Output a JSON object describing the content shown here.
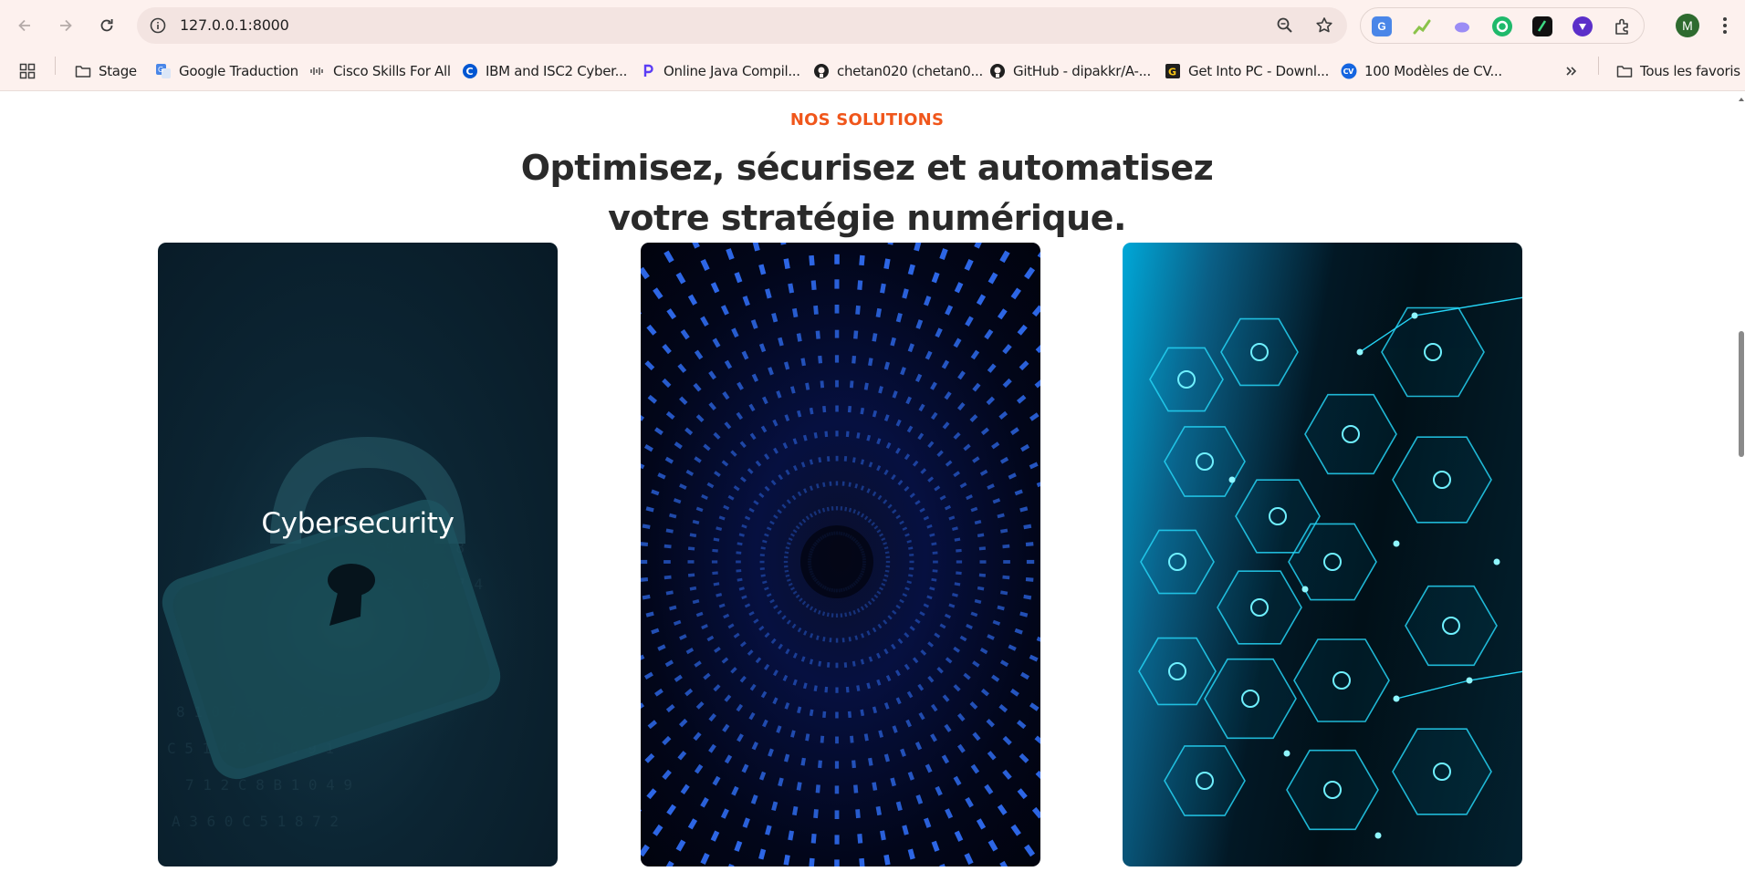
{
  "browser": {
    "url": "127.0.0.1:8000",
    "profile_initial": "M",
    "bookmarks": [
      {
        "label": "Stage",
        "icon": "folder-icon"
      },
      {
        "label": "Google Traduction",
        "icon": "google-translate-icon"
      },
      {
        "label": "Cisco Skills For All",
        "icon": "cisco-icon"
      },
      {
        "label": "IBM and ISC2 Cyber...",
        "icon": "coursera-icon"
      },
      {
        "label": "Online Java Compil...",
        "icon": "programiz-icon"
      },
      {
        "label": "chetan020 (chetan0...",
        "icon": "github-icon"
      },
      {
        "label": "GitHub - dipakkr/A-...",
        "icon": "github-icon"
      },
      {
        "label": "Get Into PC - Downl...",
        "icon": "getintopc-icon"
      },
      {
        "label": "100 Modèles de CV...",
        "icon": "cv-icon"
      }
    ],
    "all_bookmarks_label": "Tous les favoris",
    "colors": {
      "chrome_bg": "#fdf1ee",
      "omnibox_bg": "#f3e4e1",
      "avatar": "#2e6b2f"
    }
  },
  "section": {
    "eyebrow": "NOS SOLUTIONS",
    "headline": "Optimisez, sécurisez et automatisez votre stratégie numérique.",
    "accent_color": "#f0561b"
  },
  "cards": [
    {
      "title": "Cybersecurity",
      "image": "padlock-image"
    },
    {
      "title": "",
      "image": "binary-tunnel-image"
    },
    {
      "title": "",
      "image": "hexagon-network-image"
    }
  ]
}
